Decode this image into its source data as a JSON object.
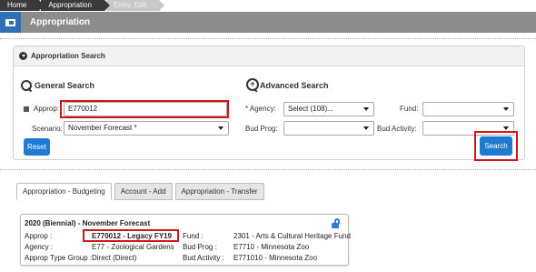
{
  "breadcrumb": {
    "items": [
      "Home",
      "Appropriation",
      "Entry, Edit"
    ]
  },
  "header": {
    "title": "Appropriation"
  },
  "search_panel": {
    "title": "Appropriation Search",
    "general": {
      "title": "General Search",
      "approp_label": "Approp:",
      "approp_value": "E770012",
      "scenario_label": "Scenario:",
      "scenario_value": "November Forecast *",
      "reset_label": "Reset"
    },
    "advanced": {
      "title": "Advanced Search",
      "agency_label": "* Agency:",
      "agency_value": "Select (108)...",
      "fund_label": "Fund:",
      "fund_value": "",
      "budprog_label": "Bud Prog:",
      "budprog_value": "",
      "budactivity_label": "Bud Activity:",
      "budactivity_value": "",
      "search_label": "Search"
    }
  },
  "tabs": [
    {
      "label": "Appropriation - Budgeting",
      "active": true
    },
    {
      "label": "Account - Add",
      "active": false
    },
    {
      "label": "Appropriation - Transfer",
      "active": false
    }
  ],
  "card": {
    "heading": "2020 (Biennial) - November Forecast",
    "approp_label": "Approp :",
    "approp_value": "E770012 - Legacy FY19",
    "agency_label": "Agency :",
    "agency_value": "E77 - Zoological Gardens",
    "type_group_label": "Approp Type Group :",
    "type_group_value": "Direct (Direct)",
    "fund_label": "Fund :",
    "fund_value": "2301 - Arts & Cultural Heritage Fund",
    "budprog_label": "Bud Prog :",
    "budprog_value": "E7710 - Minnesota Zoo",
    "budactivity_label": "Bud Activity :",
    "budactivity_value": "E771010 - Minnesota Zoo"
  },
  "colors": {
    "accent": "#1f7ad1",
    "highlight": "#d0151b",
    "titlebar": "#8c8c8c"
  }
}
